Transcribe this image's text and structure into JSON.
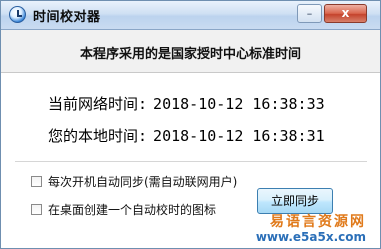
{
  "window": {
    "title": "时间校对器"
  },
  "titlebar": {
    "minimize_glyph": "–",
    "close_glyph": "x"
  },
  "header": {
    "text": "本程序采用的是国家授时中心标准时间"
  },
  "times": {
    "network_label": "当前网络时间:",
    "network_value": "2018-10-12 16:38:33",
    "local_label": "您的本地时间:",
    "local_value": "2018-10-12 16:38:31"
  },
  "options": [
    {
      "label": "每次开机自动同步(需自动联网用户)",
      "checked": false
    },
    {
      "label": "在桌面创建一个自动校时的图标",
      "checked": false
    }
  ],
  "buttons": {
    "sync_now": "立即同步"
  },
  "watermark": {
    "title": "易语言资源网",
    "url": "www.e5a5x.com"
  }
}
